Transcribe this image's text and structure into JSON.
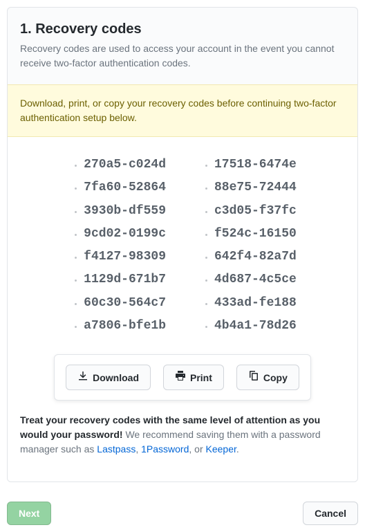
{
  "header": {
    "title": "1. Recovery codes",
    "description": "Recovery codes are used to access your account in the event you cannot receive two-factor authentication codes."
  },
  "warning": "Download, print, or copy your recovery codes before continuing two-factor authentication setup below.",
  "codes": {
    "left": [
      "270a5-c024d",
      "7fa60-52864",
      "3930b-df559",
      "9cd02-0199c",
      "f4127-98309",
      "1129d-671b7",
      "60c30-564c7",
      "a7806-bfe1b"
    ],
    "right": [
      "17518-6474e",
      "88e75-72444",
      "c3d05-f37fc",
      "f524c-16150",
      "642f4-82a7d",
      "4d687-4c5ce",
      "433ad-fe188",
      "4b4a1-78d26"
    ]
  },
  "actions": {
    "download": "Download",
    "print": "Print",
    "copy": "Copy"
  },
  "note": {
    "strong": "Treat your recovery codes with the same level of attention as you would your password!",
    "middle": " We recommend saving them with a password manager such as ",
    "lastpass": "Lastpass",
    "sep1": ", ",
    "onepassword": "1Password",
    "sep2": ", or ",
    "keeper": "Keeper",
    "end": "."
  },
  "footer": {
    "next": "Next",
    "cancel": "Cancel"
  }
}
